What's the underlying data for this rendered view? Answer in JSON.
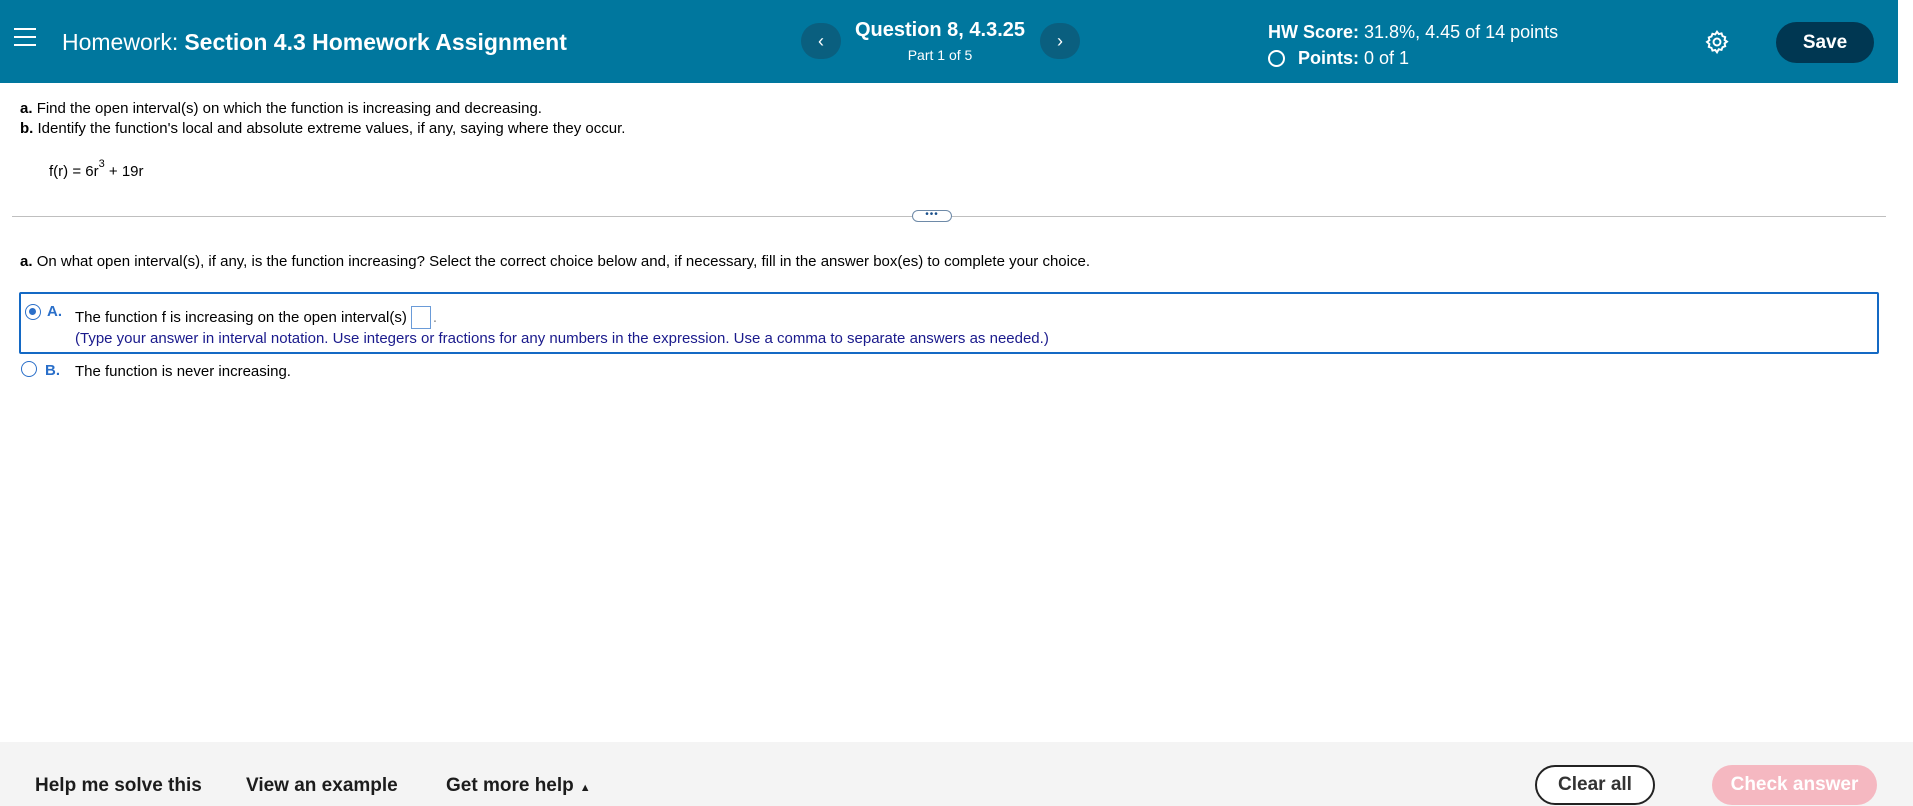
{
  "header": {
    "title_prefix": "Homework:",
    "title": "Section 4.3 Homework Assignment",
    "question_title": "Question 8, 4.3.25",
    "question_part": "Part 1 of 5",
    "prev_label": "‹",
    "next_label": "›",
    "score_label": "HW Score:",
    "score_value": "31.8%, 4.45 of 14 points",
    "points_label": "Points:",
    "points_value": "0 of 1",
    "save_label": "Save"
  },
  "problem": {
    "part_a_letter": "a.",
    "part_a_text": "Find the open interval(s) on which the function is increasing and decreasing.",
    "part_b_letter": "b.",
    "part_b_text": "Identify the function's local and absolute extreme values, if any, saying where they occur.",
    "function_lhs": "f(r) = 6r",
    "function_exp": "3",
    "function_rhs": " + 19r"
  },
  "divider_handle": "•••",
  "question": {
    "letter": "a.",
    "text": "On what open interval(s), if any, is the function increasing? Select the correct choice below and, if necessary, fill in the answer box(es) to complete your choice."
  },
  "choices": [
    {
      "letter": "A.",
      "text": "The function f is increasing on the open interval(s)",
      "after": ".",
      "hint": "(Type your answer in interval notation. Use integers or fractions for any numbers in the expression. Use a comma to separate answers as needed.)",
      "selected": true
    },
    {
      "letter": "B.",
      "text": "The function is never increasing.",
      "selected": false
    }
  ],
  "footer": {
    "help_solve": "Help me solve this",
    "view_example": "View an example",
    "more_help": "Get more help",
    "more_help_caret": "▲",
    "clear_all": "Clear all",
    "check_answer": "Check answer"
  },
  "colors": {
    "header_bg": "#00779e",
    "save_bg": "#003752",
    "selected_border": "#1469c4",
    "check_bg": "#f5b8c1"
  },
  "icons": {
    "menu": "hamburger-menu-icon",
    "settings": "gear-icon"
  }
}
